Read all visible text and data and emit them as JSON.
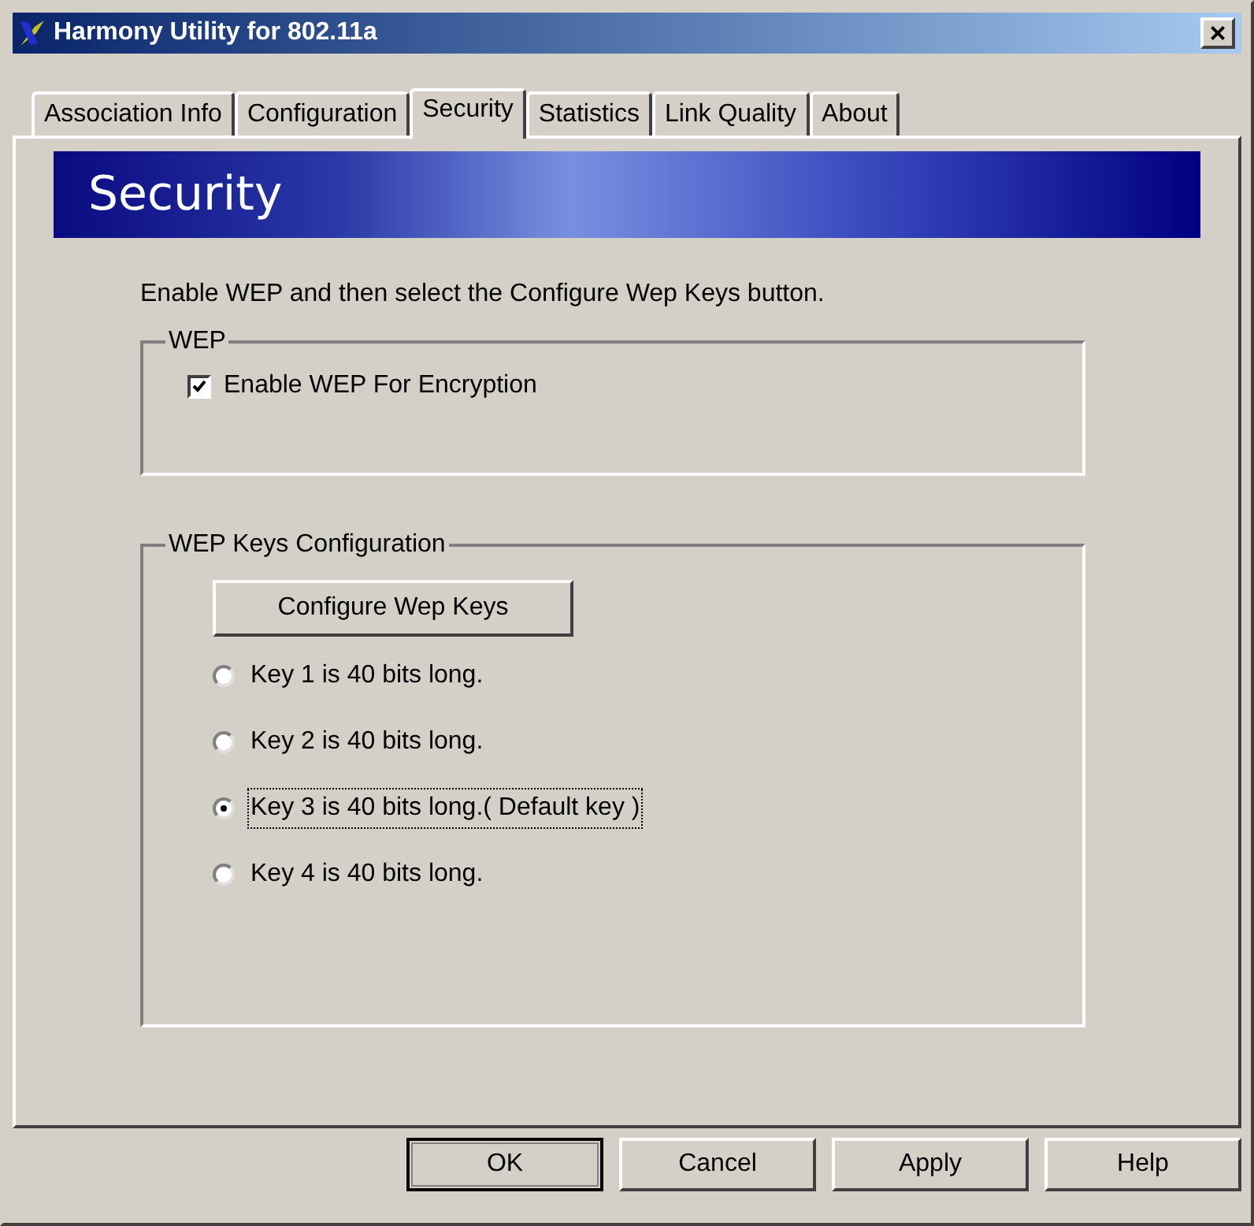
{
  "window": {
    "title": "Harmony Utility for 802.11a",
    "close": "×"
  },
  "tabs": [
    {
      "label": "Association Info",
      "selected": false
    },
    {
      "label": "Configuration",
      "selected": false
    },
    {
      "label": "Security",
      "selected": true
    },
    {
      "label": "Statistics",
      "selected": false
    },
    {
      "label": "Link Quality",
      "selected": false
    },
    {
      "label": "About",
      "selected": false
    }
  ],
  "banner": {
    "title": "Security"
  },
  "instructions": "Enable WEP and then select the Configure Wep Keys button.",
  "wep_group": {
    "legend": "WEP",
    "checkbox": {
      "label": "Enable WEP For Encryption",
      "checked": true
    }
  },
  "keys_group": {
    "legend": "WEP Keys Configuration",
    "button": "Configure Wep Keys",
    "keys": [
      {
        "label": "Key 1 is 40 bits long.",
        "selected": false
      },
      {
        "label": "Key 2 is 40 bits long.",
        "selected": false
      },
      {
        "label": "Key 3 is 40 bits long.( Default key )",
        "selected": true
      },
      {
        "label": "Key 4 is 40 bits long.",
        "selected": false
      }
    ]
  },
  "buttons": [
    {
      "label": "OK",
      "default": true
    },
    {
      "label": "Cancel",
      "default": false
    },
    {
      "label": "Apply",
      "default": false
    },
    {
      "label": "Help",
      "default": false
    }
  ]
}
